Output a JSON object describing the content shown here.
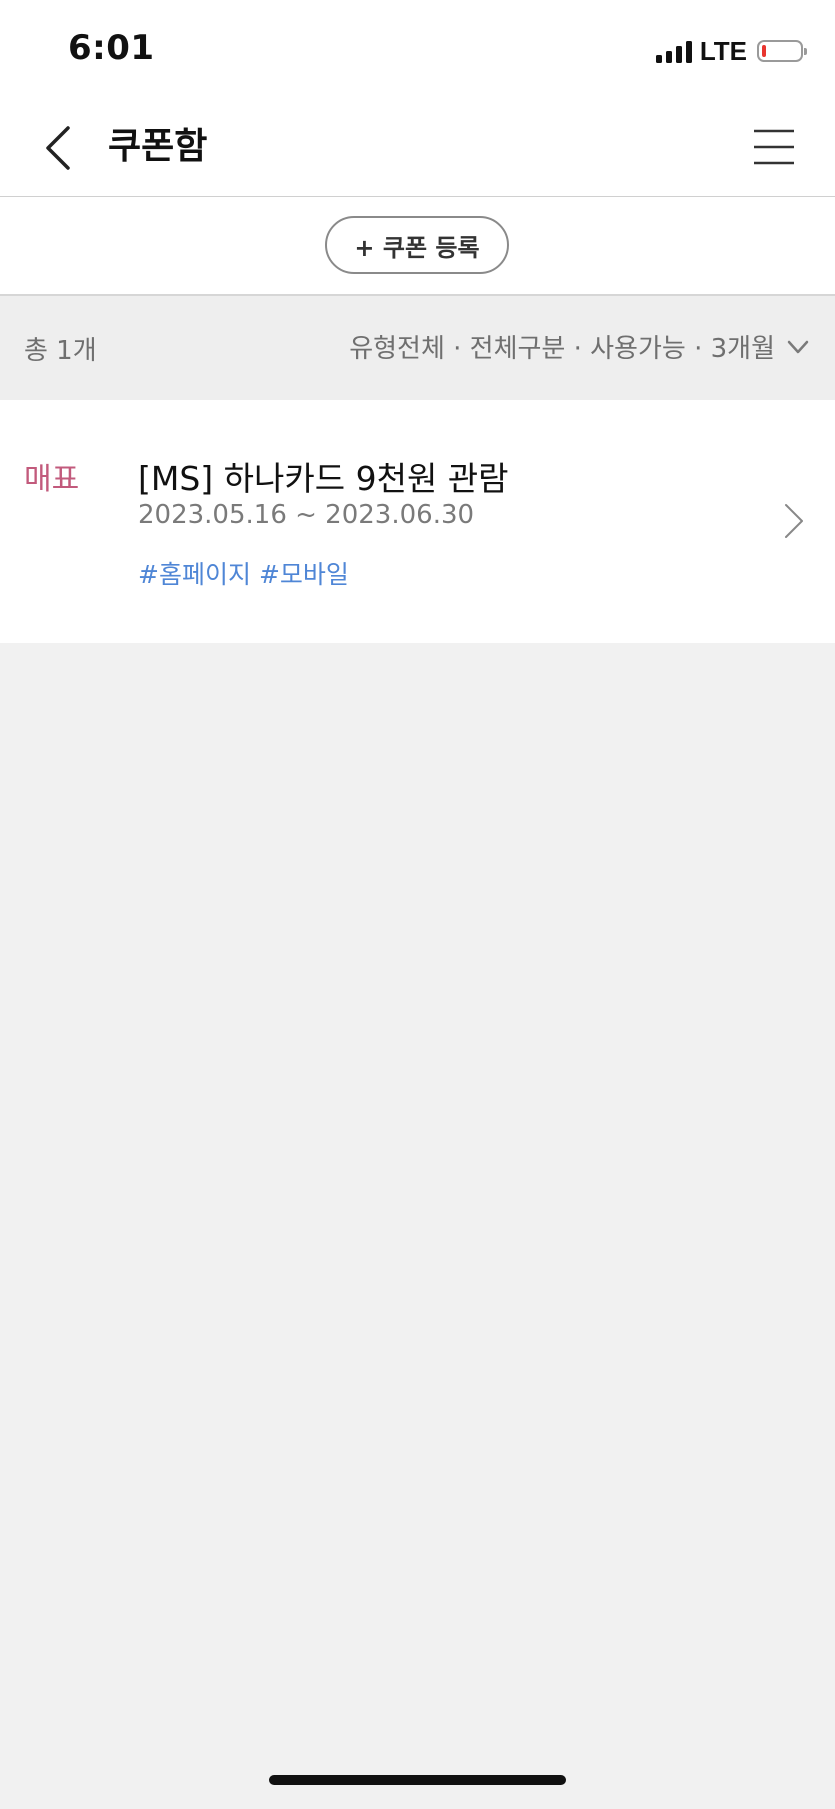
{
  "status_bar": {
    "time": "6:01",
    "network": "LTE",
    "battery_level": 0.12,
    "battery_color": "#e8352f"
  },
  "nav": {
    "title": "쿠폰함",
    "back_icon": "chevron-left-icon",
    "menu_icon": "hamburger-menu-icon"
  },
  "register": {
    "label": "+ 쿠폰 등록"
  },
  "filter": {
    "total": "총 1개",
    "summary": "유형전체 · 전체구분 · 사용가능 · 3개월",
    "icon": "chevron-down-icon"
  },
  "coupons": [
    {
      "type": "매표",
      "title": "[MS] 하나카드 9천원 관람",
      "period": "2023.05.16 ~ 2023.06.30",
      "tags": [
        "#홈페이지",
        "#모바일"
      ]
    }
  ],
  "colors": {
    "type_label": "#c25a7c",
    "tag": "#4f86d6",
    "background": "#f1f1f1"
  }
}
